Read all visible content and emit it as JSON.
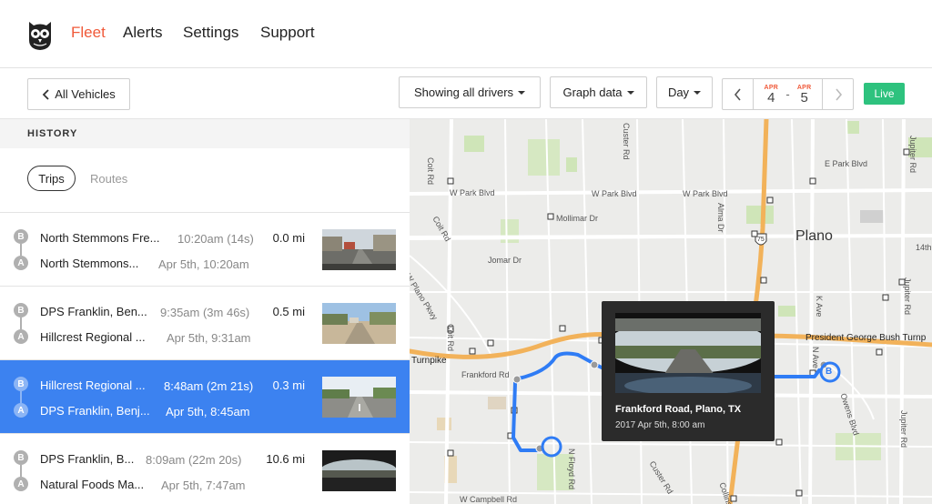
{
  "nav": {
    "items": [
      {
        "label": "Fleet",
        "active": true
      },
      {
        "label": "Alerts",
        "active": false
      },
      {
        "label": "Settings",
        "active": false
      },
      {
        "label": "Support",
        "active": false
      }
    ]
  },
  "toolbar": {
    "back_label": "All Vehicles",
    "drivers_label": "Showing all drivers",
    "graph_label": "Graph data",
    "period_label": "Day",
    "date_from": {
      "month": "APR",
      "day": "4"
    },
    "date_separator": "-",
    "date_to": {
      "month": "APR",
      "day": "5"
    },
    "live_label": "Live"
  },
  "sidebar": {
    "heading": "HISTORY",
    "tabs": [
      {
        "label": "Trips",
        "active": true
      },
      {
        "label": "Routes",
        "active": false
      }
    ],
    "trips": [
      {
        "dest": "North Stemmons Fre...",
        "origin": "North Stemmons...",
        "duration": "10:20am (14s)",
        "when": "Apr 5th, 10:20am",
        "distance": "0.0 mi",
        "selected": false
      },
      {
        "dest": "DPS Franklin, Ben...",
        "origin": "Hillcrest Regional ...",
        "duration": "9:35am (3m 46s)",
        "when": "Apr 5th, 9:31am",
        "distance": "0.5 mi",
        "selected": false
      },
      {
        "dest": "Hillcrest Regional ...",
        "origin": "DPS Franklin, Benj...",
        "duration": "8:48am (2m 21s)",
        "when": "Apr 5th, 8:45am",
        "distance": "0.3 mi",
        "selected": true
      },
      {
        "dest": "DPS Franklin, B...",
        "origin": "Natural Foods Ma...",
        "duration": "8:09am (22m 20s)",
        "when": "Apr 5th, 7:47am",
        "distance": "10.6 mi",
        "selected": false
      }
    ],
    "pin_b": "B",
    "pin_a": "A"
  },
  "map": {
    "city": "Plano",
    "streets": {
      "park_w1": "W Park Blvd",
      "park_w2": "W Park Blvd",
      "park_w3": "W Park Blvd",
      "park_e": "E Park Blvd",
      "mollimar": "Mollimar Dr",
      "jomar": "Jomar Dr",
      "plano_pkwy": "W Plano Pkwy",
      "coit1": "Coit Rd",
      "coit2": "Coit Rd",
      "coit3": "Coit Rd",
      "custer1": "Custer Rd",
      "custer2": "Custer Rd",
      "alma": "Alma Dr",
      "jupiter1": "Jupiter Rd",
      "jupiter2": "Jupiter Rd",
      "jupiter3": "Jupiter Rd",
      "k_ave": "K Ave",
      "n_ave": "N Ave",
      "owens": "Owens Blvd",
      "frankford": "Frankford Rd",
      "pgb_turnpike": "President George Bush Turnp",
      "turnpike": "Turnpike",
      "floyd": "N Floyd Rd",
      "campbell": "W Campbell Rd",
      "collins": "Collins Blvd",
      "fourteenth": "14th",
      "hwy75": "75",
      "route_b": "B"
    },
    "route_color": "#2f7cf5"
  },
  "popup": {
    "location": "Frankford Road, Plano, TX",
    "timestamp": "2017 Apr 5th, 8:00 am"
  }
}
